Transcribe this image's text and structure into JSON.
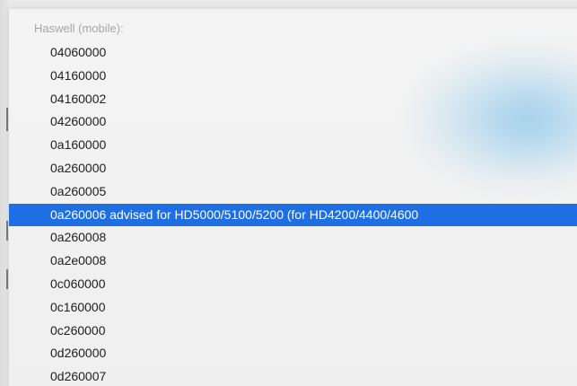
{
  "menu": {
    "header": "Haswell (mobile):",
    "items": [
      {
        "label": "04060000",
        "selected": false
      },
      {
        "label": "04160000",
        "selected": false
      },
      {
        "label": "04160002",
        "selected": false
      },
      {
        "label": "04260000",
        "selected": false
      },
      {
        "label": "0a160000",
        "selected": false
      },
      {
        "label": "0a260000",
        "selected": false
      },
      {
        "label": "0a260005",
        "selected": false
      },
      {
        "label": "0a260006 advised for HD5000/5100/5200 (for HD4200/4400/4600",
        "selected": true
      },
      {
        "label": "0a260008",
        "selected": false
      },
      {
        "label": "0a2e0008",
        "selected": false
      },
      {
        "label": "0c060000",
        "selected": false
      },
      {
        "label": "0c160000",
        "selected": false
      },
      {
        "label": "0c260000",
        "selected": false
      },
      {
        "label": "0d260000",
        "selected": false
      },
      {
        "label": "0d260007",
        "selected": false
      }
    ]
  },
  "colors": {
    "selection": "#1d6fe3",
    "header_text": "#a6a6a6",
    "item_text": "#1e1e1e",
    "menu_background": "#f2f2f2"
  }
}
